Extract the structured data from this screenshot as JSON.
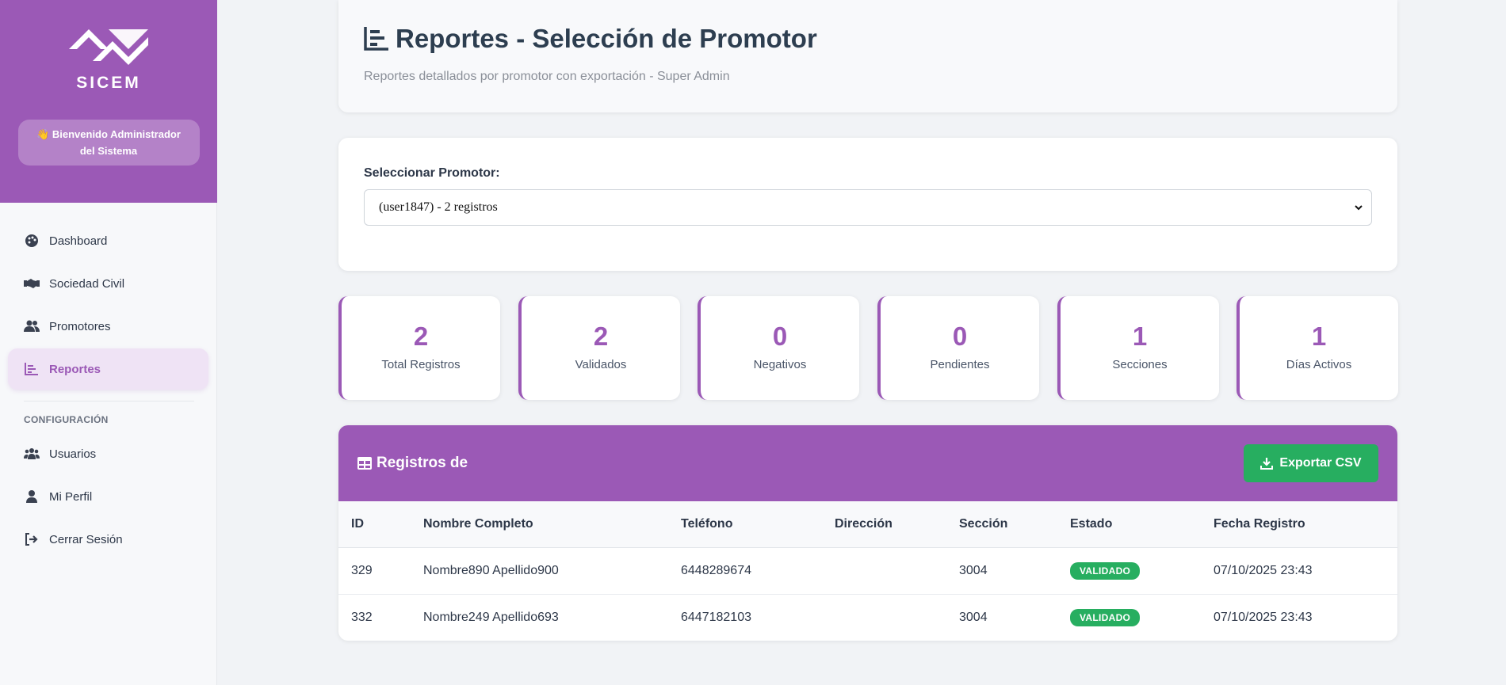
{
  "brand": {
    "name": "SICEM",
    "welcome": "👋 Bienvenido Administrador del Sistema"
  },
  "sidebar": {
    "items": [
      {
        "label": "Dashboard",
        "icon": "palette-icon"
      },
      {
        "label": "Sociedad Civil",
        "icon": "handshake-icon"
      },
      {
        "label": "Promotores",
        "icon": "users-icon"
      },
      {
        "label": "Reportes",
        "icon": "chart-icon",
        "active": true
      }
    ],
    "section_label": "CONFIGURACIÓN",
    "config_items": [
      {
        "label": "Usuarios",
        "icon": "users-group-icon"
      },
      {
        "label": "Mi Perfil",
        "icon": "user-icon"
      },
      {
        "label": "Cerrar Sesión",
        "icon": "logout-icon"
      }
    ]
  },
  "header": {
    "title": "Reportes - Selección de Promotor",
    "subtitle": "Reportes detallados por promotor con exportación - Super Admin"
  },
  "selector": {
    "label": "Seleccionar Promotor:",
    "value": "(user1847) - 2 registros"
  },
  "stats": [
    {
      "value": "2",
      "label": "Total Registros"
    },
    {
      "value": "2",
      "label": "Validados"
    },
    {
      "value": "0",
      "label": "Negativos"
    },
    {
      "value": "0",
      "label": "Pendientes"
    },
    {
      "value": "1",
      "label": "Secciones"
    },
    {
      "value": "1",
      "label": "Días Activos"
    }
  ],
  "table": {
    "title": "Registros de",
    "export_label": "Exportar CSV",
    "columns": [
      "ID",
      "Nombre Completo",
      "Teléfono",
      "Dirección",
      "Sección",
      "Estado",
      "Fecha Registro"
    ],
    "rows": [
      {
        "id": "329",
        "nombre": "Nombre890 Apellido900",
        "telefono": "6448289674",
        "direccion": "",
        "seccion": "3004",
        "estado": "VALIDADO",
        "fecha": "07/10/2025 23:43"
      },
      {
        "id": "332",
        "nombre": "Nombre249 Apellido693",
        "telefono": "6447182103",
        "direccion": "",
        "seccion": "3004",
        "estado": "VALIDADO",
        "fecha": "07/10/2025 23:43"
      }
    ]
  },
  "colors": {
    "accent": "#9b59b6",
    "success": "#27ae60"
  }
}
